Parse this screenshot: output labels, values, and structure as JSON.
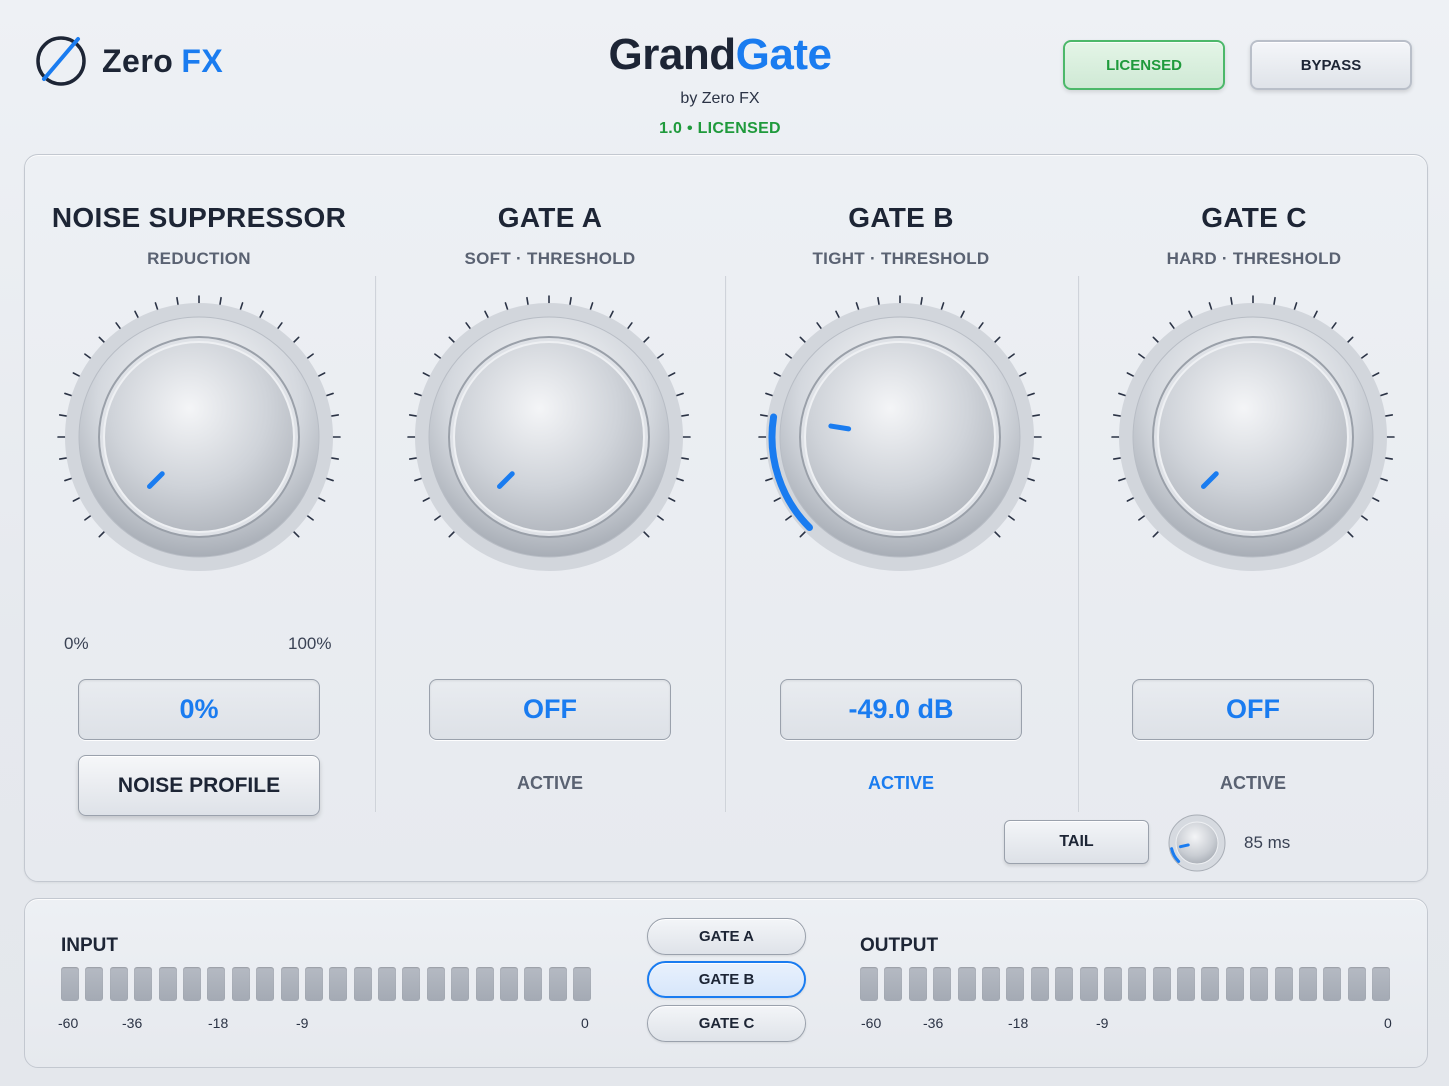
{
  "brand": {
    "name": "Zero",
    "name_accent": "FX"
  },
  "header": {
    "title_part1": "Grand",
    "title_part2": "Gate",
    "subtitle": "by Zero FX",
    "version": "1.0  •  LICENSED",
    "licensed_button": "LICENSED",
    "bypass_button": "BYPASS"
  },
  "sections": [
    {
      "title": "NOISE SUPPRESSOR",
      "subtitle": "REDUCTION",
      "value": "0%",
      "knob_level": 0.0,
      "arc": false
    },
    {
      "title": "GATE A",
      "subtitle": "SOFT · THRESHOLD",
      "value": "OFF",
      "knob_level": 0.0,
      "arc": false,
      "active": "ACTIVE",
      "active_on": false
    },
    {
      "title": "GATE B",
      "subtitle": "TIGHT · THRESHOLD",
      "value": "-49.0 dB",
      "knob_level": 0.2,
      "arc": true,
      "active": "ACTIVE",
      "active_on": true
    },
    {
      "title": "GATE C",
      "subtitle": "HARD · THRESHOLD",
      "value": "OFF",
      "knob_level": 0.0,
      "arc": false,
      "active": "ACTIVE",
      "active_on": false
    }
  ],
  "noise": {
    "range_min": "0%",
    "range_max": "100%",
    "profile_button": "NOISE PROFILE"
  },
  "tail": {
    "button": "TAIL",
    "value": "85 ms",
    "knob_level": 0.12
  },
  "meters": {
    "input": {
      "title": "INPUT",
      "segments": 22,
      "scale": [
        "-60",
        "-36",
        "-18",
        "-9",
        "0"
      ]
    },
    "output": {
      "title": "OUTPUT",
      "segments": 22,
      "scale": [
        "-60",
        "-36",
        "-18",
        "-9",
        "0"
      ]
    }
  },
  "gate_selector": [
    {
      "label": "GATE A",
      "selected": false
    },
    {
      "label": "GATE B",
      "selected": true
    },
    {
      "label": "GATE C",
      "selected": false
    }
  ],
  "colors": {
    "accent": "#1a7cf0",
    "licensed_green": "#1f9a3c",
    "text_dark": "#1d2535"
  },
  "icons": {
    "logo": "slashed-circle-icon"
  }
}
